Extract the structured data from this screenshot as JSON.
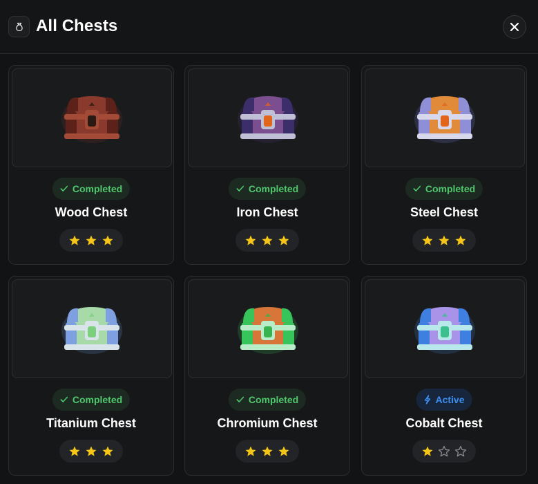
{
  "header": {
    "title": "All Chests",
    "icon": "bag-icon",
    "close_icon": "close-icon"
  },
  "colors": {
    "completed": "#4fc76d",
    "active": "#3d8ef0",
    "star_filled": "#f5c518",
    "star_empty": "#8a8d91"
  },
  "chests": [
    {
      "name": "Wood Chest",
      "status": "Completed",
      "status_type": "completed",
      "stars": 3,
      "max_stars": 3,
      "palette": {
        "body": "#8a3a2c",
        "dark": "#5c2219",
        "band": "#a44b38",
        "lock": "#2a1a14",
        "glow": "#8a3a2c"
      }
    },
    {
      "name": "Iron Chest",
      "status": "Completed",
      "status_type": "completed",
      "stars": 3,
      "max_stars": 3,
      "palette": {
        "body": "#7a4e8f",
        "dark": "#3c2d6b",
        "band": "#bfbfd6",
        "lock": "#e2651c",
        "glow": "#5a3f8a"
      }
    },
    {
      "name": "Steel Chest",
      "status": "Completed",
      "status_type": "completed",
      "stars": 3,
      "max_stars": 3,
      "palette": {
        "body": "#e08a3a",
        "dark": "#8f8fd8",
        "band": "#d7d8ec",
        "lock": "#e2651c",
        "glow": "#7f8ff0"
      }
    },
    {
      "name": "Titanium Chest",
      "status": "Completed",
      "status_type": "completed",
      "stars": 3,
      "max_stars": 3,
      "palette": {
        "body": "#a8d9a8",
        "dark": "#7ea0e0",
        "band": "#d8e4ea",
        "lock": "#7bd07b",
        "glow": "#6fa0f0"
      }
    },
    {
      "name": "Chromium Chest",
      "status": "Completed",
      "status_type": "completed",
      "stars": 3,
      "max_stars": 3,
      "palette": {
        "body": "#d8763a",
        "dark": "#37c45a",
        "band": "#b9ecc8",
        "lock": "#39b34f",
        "glow": "#3fd063"
      }
    },
    {
      "name": "Cobalt Chest",
      "status": "Active",
      "status_type": "active",
      "stars": 1,
      "max_stars": 3,
      "palette": {
        "body": "#a993e8",
        "dark": "#3f7fe0",
        "band": "#b8e8ea",
        "lock": "#3cbf8c",
        "glow": "#4f8ff0"
      }
    }
  ]
}
